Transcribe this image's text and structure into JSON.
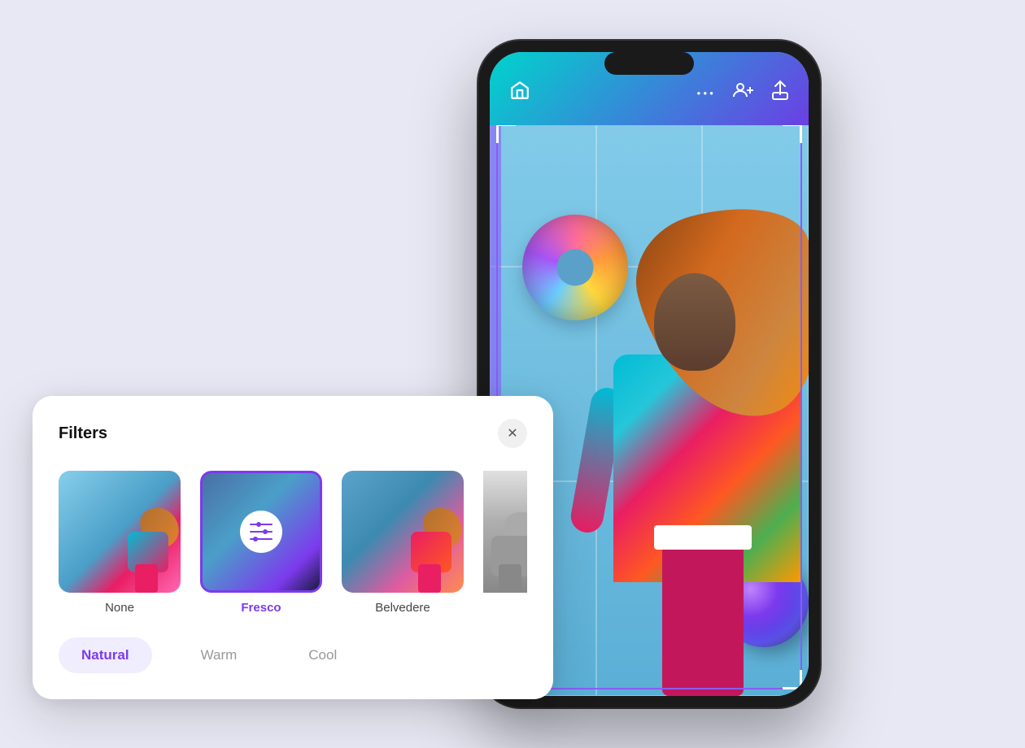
{
  "app": {
    "background_color": "#e8e8f4"
  },
  "phone": {
    "topbar": {
      "home_icon": "⌂",
      "more_icon": "•••",
      "add_contact_icon": "👥",
      "share_icon": "↑"
    }
  },
  "filters_panel": {
    "title": "Filters",
    "close_label": "✕",
    "thumbnails": [
      {
        "label": "None",
        "id": "none"
      },
      {
        "label": "Fresco",
        "id": "fresco",
        "selected": true
      },
      {
        "label": "Belvedere",
        "id": "belvedere"
      },
      {
        "label": "",
        "id": "fourth"
      }
    ],
    "tones": [
      {
        "label": "Natural",
        "active": true
      },
      {
        "label": "Warm",
        "active": false
      },
      {
        "label": "Cool",
        "active": false
      }
    ]
  }
}
